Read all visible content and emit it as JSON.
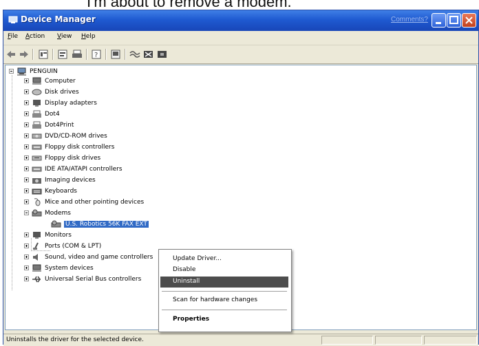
{
  "caption": {
    "text": "I'm about to remove a modem."
  },
  "window": {
    "title": "Device Manager",
    "comments_link": "Comments?",
    "title_color": "#1f5ad1"
  },
  "menubar": {
    "items": [
      {
        "label": "File"
      },
      {
        "label": "Action"
      },
      {
        "label": "View"
      },
      {
        "label": "Help"
      }
    ]
  },
  "toolbar": {
    "buttons": [
      {
        "icon": "back-arrow-icon"
      },
      {
        "icon": "forward-arrow-icon"
      },
      {
        "icon": "console-tree-icon"
      },
      {
        "icon": "properties-icon"
      },
      {
        "icon": "print-icon"
      },
      {
        "icon": "help-icon"
      },
      {
        "icon": "scan-hardware-icon"
      },
      {
        "icon": "update-driver-icon"
      },
      {
        "icon": "uninstall-icon"
      },
      {
        "icon": "disable-icon"
      }
    ]
  },
  "tree": {
    "root": "PENGUIN",
    "categories": [
      {
        "label": "Computer",
        "icon": "computer-icon"
      },
      {
        "label": "Disk drives",
        "icon": "disk-drive-icon"
      },
      {
        "label": "Display adapters",
        "icon": "monitor-icon"
      },
      {
        "label": "Dot4",
        "icon": "printer-icon"
      },
      {
        "label": "Dot4Print",
        "icon": "printer-icon"
      },
      {
        "label": "DVD/CD-ROM drives",
        "icon": "cd-drive-icon"
      },
      {
        "label": "Floppy disk controllers",
        "icon": "controller-icon"
      },
      {
        "label": "Floppy disk drives",
        "icon": "floppy-drive-icon"
      },
      {
        "label": "IDE ATA/ATAPI controllers",
        "icon": "controller-icon"
      },
      {
        "label": "Imaging devices",
        "icon": "camera-icon"
      },
      {
        "label": "Keyboards",
        "icon": "keyboard-icon"
      },
      {
        "label": "Mice and other pointing devices",
        "icon": "mouse-icon"
      },
      {
        "label": "Modems",
        "icon": "modem-icon"
      },
      {
        "label": "U.S. Robotics 56K FAX EXT",
        "icon": "modem-icon"
      },
      {
        "label": "Monitors",
        "icon": "monitor-icon"
      },
      {
        "label": "Ports (COM & LPT)",
        "icon": "port-icon"
      },
      {
        "label": "Sound, video and game controllers",
        "icon": "sound-icon"
      },
      {
        "label": "System devices",
        "icon": "computer-icon"
      },
      {
        "label": "Universal Serial Bus controllers",
        "icon": "usb-icon"
      }
    ]
  },
  "context_menu": {
    "items": [
      {
        "label": "Update Driver..."
      },
      {
        "label": "Disable"
      },
      {
        "label": "Uninstall",
        "highlighted": true
      },
      {
        "label": "Scan for hardware changes"
      },
      {
        "label": "Properties",
        "bold": true
      }
    ]
  },
  "statusbar": {
    "text": "Uninstalls the driver for the selected device."
  }
}
